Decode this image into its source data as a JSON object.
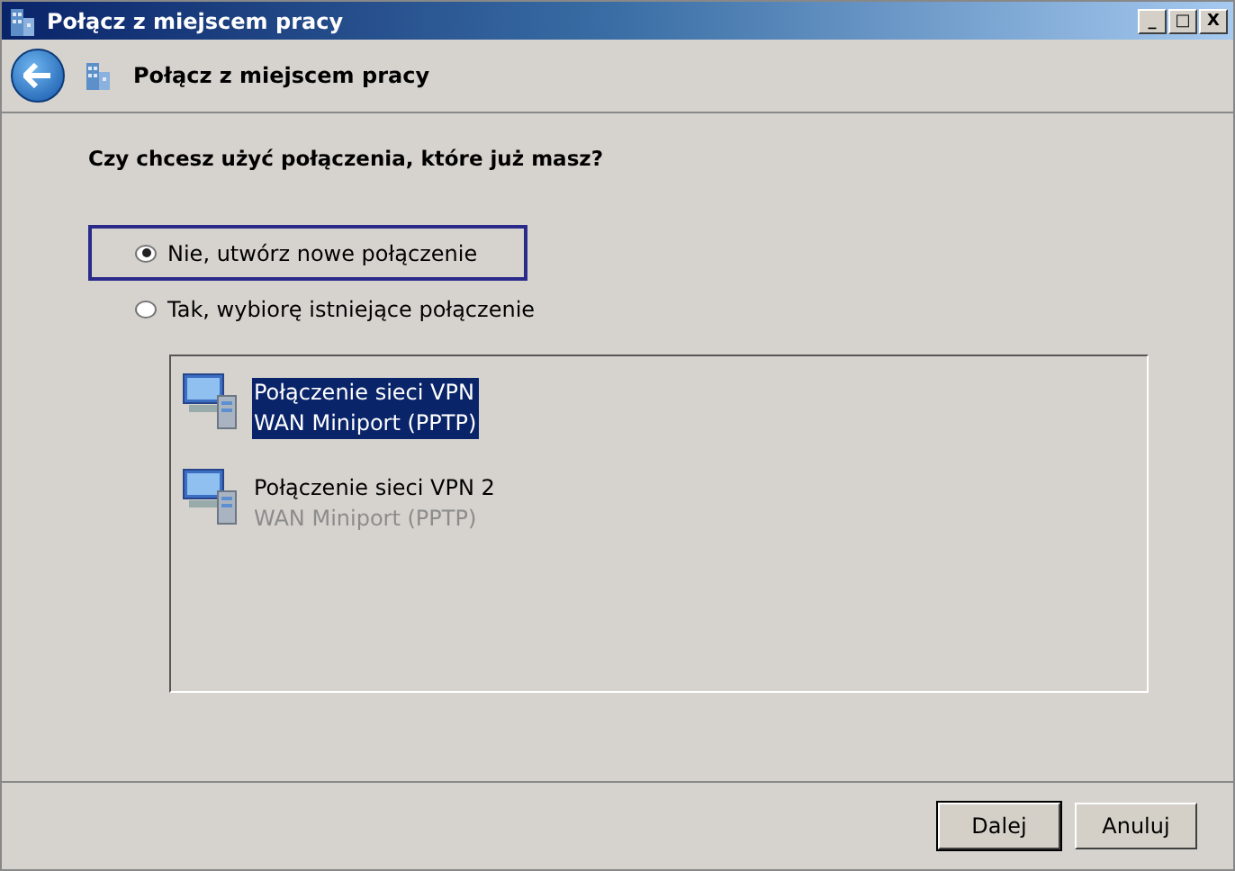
{
  "window": {
    "title": "Połącz z miejscem pracy",
    "controls": [
      "_",
      "□",
      "X"
    ]
  },
  "header": {
    "title": "Połącz z miejscem pracy"
  },
  "question": "Czy chcesz użyć połączenia, które już masz?",
  "options": [
    {
      "label": "Nie, utwórz nowe połączenie",
      "selected": true,
      "focused": true
    },
    {
      "label": "Tak, wybiorę istniejące połączenie",
      "selected": false,
      "focused": false
    }
  ],
  "connections": [
    {
      "name": "Połączenie sieci VPN",
      "device": "WAN Miniport (PPTP)",
      "selected": true
    },
    {
      "name": "Połączenie sieci VPN 2",
      "device": "WAN Miniport (PPTP)",
      "selected": false
    }
  ],
  "buttons": [
    {
      "label": "Dalej",
      "default": true
    },
    {
      "label": "Anuluj",
      "default": false
    }
  ]
}
